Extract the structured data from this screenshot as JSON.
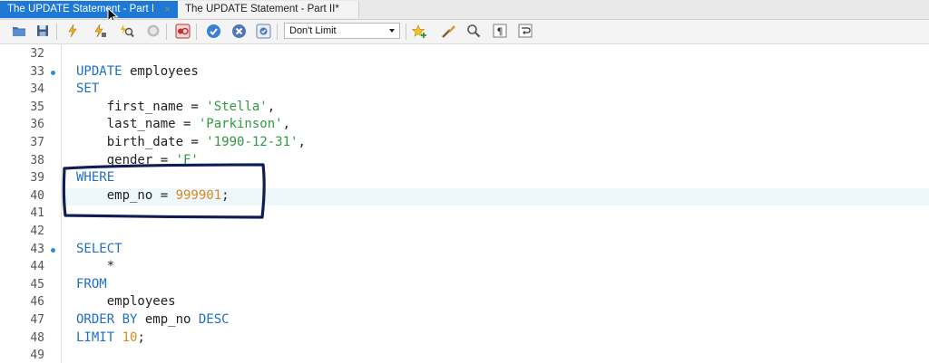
{
  "tabs": {
    "active": {
      "label": "The UPDATE Statement - Part I"
    },
    "inactive": {
      "label": "The UPDATE Statement - Part II*"
    },
    "close_glyph": "×"
  },
  "toolbar": {
    "limit_select": {
      "value": "Don't Limit"
    },
    "icons": [
      "open-folder-icon",
      "save-icon",
      "execute-icon",
      "execute-cursor-icon",
      "explain-icon",
      "stop-icon",
      "toggle-error-icon",
      "commit-icon",
      "rollback-icon",
      "autocommit-icon",
      "bookmark-icon",
      "beautify-icon",
      "find-icon",
      "invisibles-icon",
      "wrap-icon"
    ]
  },
  "editor": {
    "lines": [
      {
        "n": "32",
        "dot": false,
        "tokens": []
      },
      {
        "n": "33",
        "dot": true,
        "tokens": [
          {
            "t": "kw",
            "v": "UPDATE"
          },
          {
            "t": "p",
            "v": " employees"
          }
        ]
      },
      {
        "n": "34",
        "dot": false,
        "tokens": [
          {
            "t": "kw",
            "v": "SET"
          }
        ]
      },
      {
        "n": "35",
        "dot": false,
        "tokens": [
          {
            "t": "p",
            "v": "    first_name = "
          },
          {
            "t": "str",
            "v": "'Stella'"
          },
          {
            "t": "p",
            "v": ","
          }
        ]
      },
      {
        "n": "36",
        "dot": false,
        "tokens": [
          {
            "t": "p",
            "v": "    last_name = "
          },
          {
            "t": "str",
            "v": "'Parkinson'"
          },
          {
            "t": "p",
            "v": ","
          }
        ]
      },
      {
        "n": "37",
        "dot": false,
        "tokens": [
          {
            "t": "p",
            "v": "    birth_date = "
          },
          {
            "t": "str",
            "v": "'1990-12-31'"
          },
          {
            "t": "p",
            "v": ","
          }
        ]
      },
      {
        "n": "38",
        "dot": false,
        "tokens": [
          {
            "t": "p",
            "v": "    gender = "
          },
          {
            "t": "str",
            "v": "'F'"
          }
        ]
      },
      {
        "n": "39",
        "dot": false,
        "tokens": [
          {
            "t": "kw",
            "v": "WHERE"
          }
        ]
      },
      {
        "n": "40",
        "dot": false,
        "tokens": [
          {
            "t": "p",
            "v": "    emp_no = "
          },
          {
            "t": "num",
            "v": "999901"
          },
          {
            "t": "p",
            "v": ";"
          }
        ]
      },
      {
        "n": "41",
        "dot": false,
        "tokens": []
      },
      {
        "n": "42",
        "dot": false,
        "tokens": []
      },
      {
        "n": "43",
        "dot": true,
        "tokens": [
          {
            "t": "kw",
            "v": "SELECT"
          }
        ]
      },
      {
        "n": "44",
        "dot": false,
        "tokens": [
          {
            "t": "p",
            "v": "    *"
          }
        ]
      },
      {
        "n": "45",
        "dot": false,
        "tokens": [
          {
            "t": "kw",
            "v": "FROM"
          }
        ]
      },
      {
        "n": "46",
        "dot": false,
        "tokens": [
          {
            "t": "p",
            "v": "    employees"
          }
        ]
      },
      {
        "n": "47",
        "dot": false,
        "tokens": [
          {
            "t": "kw",
            "v": "ORDER BY"
          },
          {
            "t": "p",
            "v": " emp_no "
          },
          {
            "t": "kw",
            "v": "DESC"
          }
        ]
      },
      {
        "n": "48",
        "dot": false,
        "tokens": [
          {
            "t": "kw",
            "v": "LIMIT"
          },
          {
            "t": "p",
            "v": " "
          },
          {
            "t": "num",
            "v": "10"
          },
          {
            "t": "p",
            "v": ";"
          }
        ]
      },
      {
        "n": "49",
        "dot": false,
        "tokens": []
      }
    ]
  },
  "colors": {
    "accent": "#1e78d6",
    "keyword": "#1e6fc4",
    "string": "#2f9a3f",
    "number": "#d88a1f",
    "annotation": "#0e1d54"
  }
}
